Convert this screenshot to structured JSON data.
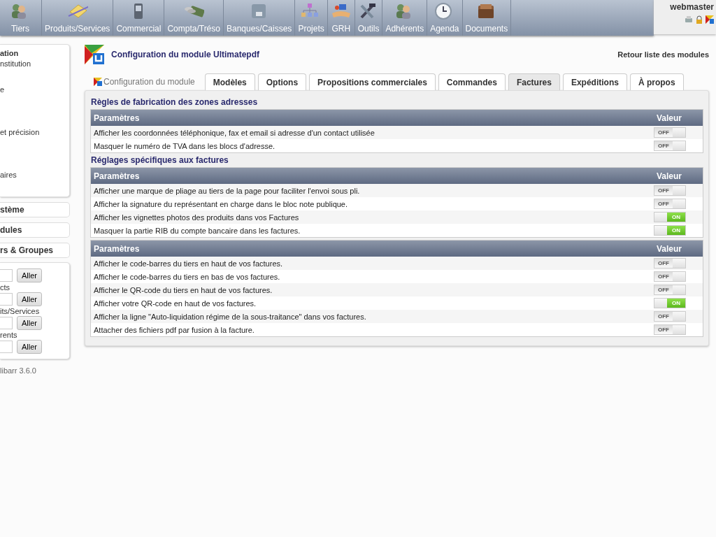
{
  "top_menu": [
    {
      "label": "Tiers"
    },
    {
      "label": "Produits/Services"
    },
    {
      "label": "Commercial"
    },
    {
      "label": "Compta/Tréso"
    },
    {
      "label": "Banques/Caisses"
    },
    {
      "label": "Projets"
    },
    {
      "label": "GRH"
    },
    {
      "label": "Outils"
    },
    {
      "label": "Adhérents"
    },
    {
      "label": "Agenda"
    },
    {
      "label": "Documents"
    }
  ],
  "user": {
    "login": "webmaster"
  },
  "sidebar": {
    "menu_items": [
      {
        "label": "ation",
        "bold": true
      },
      {
        "label": "nstitution",
        "bold": false
      },
      {
        "label": "e",
        "bold": false
      },
      {
        "label": "et précision",
        "bold": false
      },
      {
        "label": "aires",
        "bold": false
      }
    ],
    "sections": [
      "stème",
      "dules",
      "rs & Groupes"
    ],
    "searches": [
      {
        "button": "Aller"
      },
      {
        "label": "cts",
        "button": "Aller"
      },
      {
        "label": "its/Services",
        "button": "Aller"
      },
      {
        "label": "rents",
        "button": "Aller"
      }
    ],
    "version": "libarr 3.6.0"
  },
  "page": {
    "title": "Configuration du module Ultimatepdf",
    "back_link": "Retour liste des modules"
  },
  "tabs": [
    {
      "label": "Configuration du module",
      "kind": "head",
      "selected": false
    },
    {
      "label": "Modèles",
      "kind": "tab",
      "selected": false
    },
    {
      "label": "Options",
      "kind": "tab",
      "selected": false
    },
    {
      "label": "Propositions commerciales",
      "kind": "tab",
      "selected": false
    },
    {
      "label": "Commandes",
      "kind": "tab",
      "selected": false
    },
    {
      "label": "Factures",
      "kind": "tab",
      "selected": true
    },
    {
      "label": "Expéditions",
      "kind": "tab",
      "selected": false
    },
    {
      "label": "À propos",
      "kind": "tab",
      "selected": false
    }
  ],
  "sections": [
    {
      "title": "Règles de fabrication des zones adresses",
      "columns": [
        "Paramètres",
        "Valeur"
      ],
      "rows": [
        {
          "label": "Afficher les coordonnées téléphonique, fax et email si adresse d'un contact utilisée",
          "on": false,
          "switch_text": "OFF"
        },
        {
          "label": "Masquer le numéro de TVA dans les blocs d'adresse.",
          "on": false,
          "switch_text": "OFF"
        }
      ]
    },
    {
      "title": "Réglages spécifiques aux factures",
      "columns": [
        "Paramètres",
        "Valeur"
      ],
      "rows": [
        {
          "label": "Afficher une marque de pliage au tiers de la page pour faciliter l'envoi sous pli.",
          "on": false,
          "switch_text": "OFF"
        },
        {
          "label": "Afficher la signature du représentant en charge dans le bloc note publique.",
          "on": false,
          "switch_text": "OFF"
        },
        {
          "label": "Afficher les vignettes photos des produits dans vos Factures",
          "on": true,
          "switch_text": "ON"
        },
        {
          "label": "Masquer la partie RIB du compte bancaire dans les factures.",
          "on": true,
          "switch_text": "ON"
        }
      ]
    },
    {
      "columns": [
        "Paramètres",
        "Valeur"
      ],
      "rows": [
        {
          "label": "Afficher le code-barres du tiers en haut de vos factures.",
          "on": false,
          "switch_text": "OFF"
        },
        {
          "label": "Afficher le code-barres du tiers en bas de vos factures.",
          "on": false,
          "switch_text": "OFF"
        },
        {
          "label": "Afficher le QR-code du tiers en haut de vos factures.",
          "on": false,
          "switch_text": "OFF"
        },
        {
          "label": "Afficher votre QR-code en haut de vos factures.",
          "on": true,
          "switch_text": "ON"
        },
        {
          "label": "Afficher la ligne \"Auto-liquidation régime de la sous-traitance\" dans vos factures.",
          "on": false,
          "switch_text": "OFF"
        },
        {
          "label": "Attacher des fichiers pdf par fusion à la facture.",
          "on": false,
          "switch_text": "OFF"
        }
      ]
    }
  ]
}
